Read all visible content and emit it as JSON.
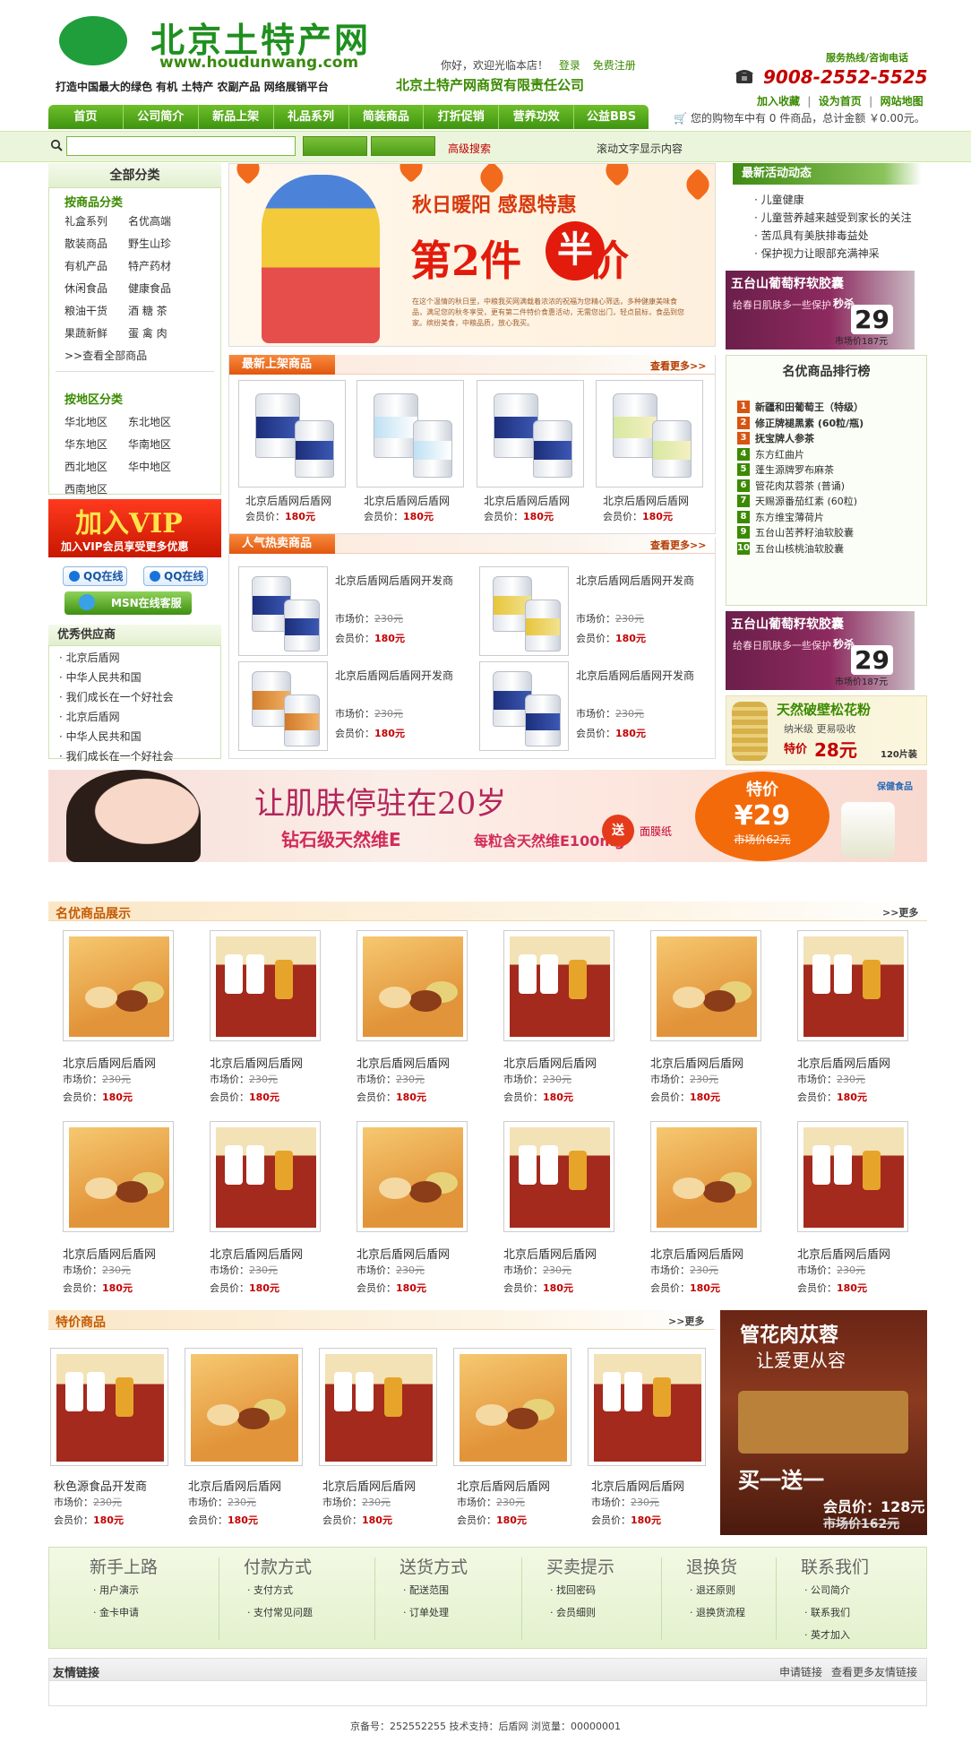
{
  "header": {
    "site_title": "北京土特产网",
    "site_url": "www.houdunwang.com",
    "slogan": "打造中国最大的绿色 有机 土特产 农副产品 网络展销平台",
    "welcome": "你好，欢迎光临本店！",
    "login": "登录",
    "register": "免费注册",
    "company": "北京土特产网商贸有限责任公司",
    "hotline_label": "服务热线/咨询电话",
    "phone": "9008-2552-5525",
    "links": [
      "加入收藏",
      "设为首页",
      "网站地图"
    ]
  },
  "nav": [
    "首页",
    "公司简介",
    "新品上架",
    "礼品系列",
    "简装商品",
    "打折促销",
    "营养功效",
    "公益BBS"
  ],
  "cart": {
    "text": "您的购物车中有 0 件商品，总计金额 ￥0.00元。"
  },
  "search": {
    "placeholder": "",
    "advanced": "高级搜索",
    "marquee": "滚动文字显示内容"
  },
  "categories": {
    "title": "全部分类",
    "product_head": "按商品分类",
    "product_items": [
      [
        "礼盒系列",
        "名优高端"
      ],
      [
        "散装商品",
        "野生山珍"
      ],
      [
        "有机产品",
        "特产药材"
      ],
      [
        "休闲食品",
        "健康食品"
      ],
      [
        "粮油干货",
        "酒 糖 茶"
      ],
      [
        "果蔬新鲜",
        "蛋 禽 肉"
      ]
    ],
    "view_all": ">>查看全部商品",
    "region_head": "按地区分类",
    "region_items": [
      [
        "华北地区",
        "东北地区"
      ],
      [
        "华东地区",
        "华南地区"
      ],
      [
        "西北地区",
        "华中地区"
      ],
      [
        "西南地区",
        ""
      ]
    ]
  },
  "vip": {
    "title": "加入VIP",
    "subtitle": "加入VIP会员享受更多优惠"
  },
  "service": {
    "qq1": "QQ在线",
    "qq2": "QQ在线",
    "msn": "MSN在线客服"
  },
  "suppliers": {
    "title": "优秀供应商",
    "items": [
      "北京后盾网",
      "中华人民共和国",
      "我们成长在一个好社会",
      "北京后盾网",
      "中华人民共和国",
      "我们成长在一个好社会"
    ]
  },
  "banner": {
    "line1": "秋日暖阳  感恩特惠",
    "line2": "第2件",
    "half": "半",
    "line2_end": "价",
    "small": "在这个温情的秋日里，中粮我买网满载着浓浓的祝福为您精心筛选，多种健康美味食品，满足您的秋冬享受，更有第二件特价食惠活动，无需您出门，轻点鼠标，食品到您家。缤纷美食，中粮品质，放心我买。"
  },
  "news": {
    "title": "最新活动动态",
    "items": [
      "儿童健康",
      "儿童营养越来越受到家长的关注",
      "苦瓜具有美肤排毒益处",
      "保护视力让眼部充满神采"
    ]
  },
  "grape_ad": {
    "title": "五台山葡萄籽软胶囊",
    "sub": "给春日肌肤多一些保护",
    "flash": "秒杀",
    "price": "29",
    "old": "市场价187元"
  },
  "ranking": {
    "title": "名优商品排行榜",
    "items": [
      "新疆和田葡萄王（特级）",
      "修正牌褪黑素 (60粒/瓶)",
      "抚宝牌人参茶",
      "东方红曲片",
      "蓬生源牌罗布麻茶",
      "管花肉苁蓉茶 (普诵)",
      "天赐源番茄红素 (60粒)",
      "东方维宝薄荷片",
      "五台山苦荞籽油软胶囊",
      "五台山核桃油软胶囊"
    ],
    "num_colors": [
      "#d8540f",
      "#d8540f",
      "#d8540f",
      "#3b8a00",
      "#3b8a00",
      "#3b8a00",
      "#3b8a00",
      "#3b8a00",
      "#3b8a00",
      "#3b8a00"
    ]
  },
  "pine_ad": {
    "title": "天然破壁松花粉",
    "sub": "纳米级 更易吸收",
    "price_label": "特价",
    "price": "28元",
    "pack": "120片装"
  },
  "new_products": {
    "title": "最新上架商品",
    "more": "查看更多>>",
    "items": [
      {
        "name": "北京后盾网后盾网",
        "member_label": "会员价：",
        "price": "180元"
      },
      {
        "name": "北京后盾网后盾网",
        "member_label": "会员价：",
        "price": "180元"
      },
      {
        "name": "北京后盾网后盾网",
        "member_label": "会员价：",
        "price": "180元"
      },
      {
        "name": "北京后盾网后盾网",
        "member_label": "会员价：",
        "price": "180元"
      }
    ]
  },
  "hot_products": {
    "title": "人气热卖商品",
    "more": "查看更多>>",
    "items": [
      {
        "name": "北京后盾网后盾网开发商",
        "market_label": "市场价：",
        "market": "230元",
        "member_label": "会员价：",
        "price": "180元"
      },
      {
        "name": "北京后盾网后盾网开发商",
        "market_label": "市场价：",
        "market": "230元",
        "member_label": "会员价：",
        "price": "180元"
      },
      {
        "name": "北京后盾网后盾网开发商",
        "market_label": "市场价：",
        "market": "230元",
        "member_label": "会员价：",
        "price": "180元"
      },
      {
        "name": "北京后盾网后盾网开发商",
        "market_label": "市场价：",
        "market": "230元",
        "member_label": "会员价：",
        "price": "180元"
      }
    ]
  },
  "wide_banner": {
    "t1": "让肌肤停驻在20岁",
    "t2": "钻石级天然维E",
    "t3": "每粒含天然维E100mg",
    "gift": "送",
    "gift_text": "面膜纸",
    "price_label": "特价",
    "price": "¥29",
    "old": "市场价62元",
    "badge": "保健食品"
  },
  "featured": {
    "title": "名优商品展示",
    "more": ">>更多",
    "items": [
      {
        "name": "北京后盾网后盾网",
        "market_label": "市场价：",
        "market": "230元",
        "member_label": "会员价：",
        "price": "180元"
      },
      {
        "name": "北京后盾网后盾网",
        "market_label": "市场价：",
        "market": "230元",
        "member_label": "会员价：",
        "price": "180元"
      },
      {
        "name": "北京后盾网后盾网",
        "market_label": "市场价：",
        "market": "230元",
        "member_label": "会员价：",
        "price": "180元"
      },
      {
        "name": "北京后盾网后盾网",
        "market_label": "市场价：",
        "market": "230元",
        "member_label": "会员价：",
        "price": "180元"
      },
      {
        "name": "北京后盾网后盾网",
        "market_label": "市场价：",
        "market": "230元",
        "member_label": "会员价：",
        "price": "180元"
      },
      {
        "name": "北京后盾网后盾网",
        "market_label": "市场价：",
        "market": "230元",
        "member_label": "会员价：",
        "price": "180元"
      },
      {
        "name": "北京后盾网后盾网",
        "market_label": "市场价：",
        "market": "230元",
        "member_label": "会员价：",
        "price": "180元"
      },
      {
        "name": "北京后盾网后盾网",
        "market_label": "市场价：",
        "market": "230元",
        "member_label": "会员价：",
        "price": "180元"
      },
      {
        "name": "北京后盾网后盾网",
        "market_label": "市场价：",
        "market": "230元",
        "member_label": "会员价：",
        "price": "180元"
      },
      {
        "name": "北京后盾网后盾网",
        "market_label": "市场价：",
        "market": "230元",
        "member_label": "会员价：",
        "price": "180元"
      },
      {
        "name": "北京后盾网后盾网",
        "market_label": "市场价：",
        "market": "230元",
        "member_label": "会员价：",
        "price": "180元"
      },
      {
        "name": "北京后盾网后盾网",
        "market_label": "市场价：",
        "market": "230元",
        "member_label": "会员价：",
        "price": "180元"
      }
    ]
  },
  "special": {
    "title": "特价商品",
    "more": ">>更多",
    "items": [
      {
        "name": "秋色源食品开发商",
        "market_label": "市场价：",
        "market": "230元",
        "member_label": "会员价：",
        "price": "180元"
      },
      {
        "name": "北京后盾网后盾网",
        "market_label": "市场价：",
        "market": "230元",
        "member_label": "会员价：",
        "price": "180元"
      },
      {
        "name": "北京后盾网后盾网",
        "market_label": "市场价：",
        "market": "230元",
        "member_label": "会员价：",
        "price": "180元"
      },
      {
        "name": "北京后盾网后盾网",
        "market_label": "市场价：",
        "market": "230元",
        "member_label": "会员价：",
        "price": "180元"
      },
      {
        "name": "北京后盾网后盾网",
        "market_label": "市场价：",
        "market": "230元",
        "member_label": "会员价：",
        "price": "180元"
      }
    ]
  },
  "special_ad": {
    "t1": "管花肉苁蓉",
    "t2": "让爱更从容",
    "t3": "买一送一",
    "price": "会员价：128元",
    "old": "市场价162元"
  },
  "help": [
    {
      "title": "新手上路",
      "items": [
        "用户演示",
        "金卡申请"
      ]
    },
    {
      "title": "付款方式",
      "items": [
        "支付方式",
        "支付常见问题"
      ]
    },
    {
      "title": "送货方式",
      "items": [
        "配送范围",
        "订单处理"
      ]
    },
    {
      "title": "买卖提示",
      "items": [
        "找回密码",
        "会员细则"
      ]
    },
    {
      "title": "退换货",
      "items": [
        "退还原则",
        "退换货流程"
      ]
    },
    {
      "title": "联系我们",
      "items": [
        "公司简介",
        "联系我们",
        "英才加入"
      ]
    }
  ],
  "friend_links": {
    "title": "友情链接",
    "apply": "申请链接",
    "view_more": "查看更多友情链接"
  },
  "footer": {
    "text": "京备号：252552255     技术支持：后盾网     浏览量：00000001"
  },
  "colors": {
    "brand_green": "#3b8a00",
    "accent_red": "#c40000",
    "section_orange": "#e2570e"
  }
}
